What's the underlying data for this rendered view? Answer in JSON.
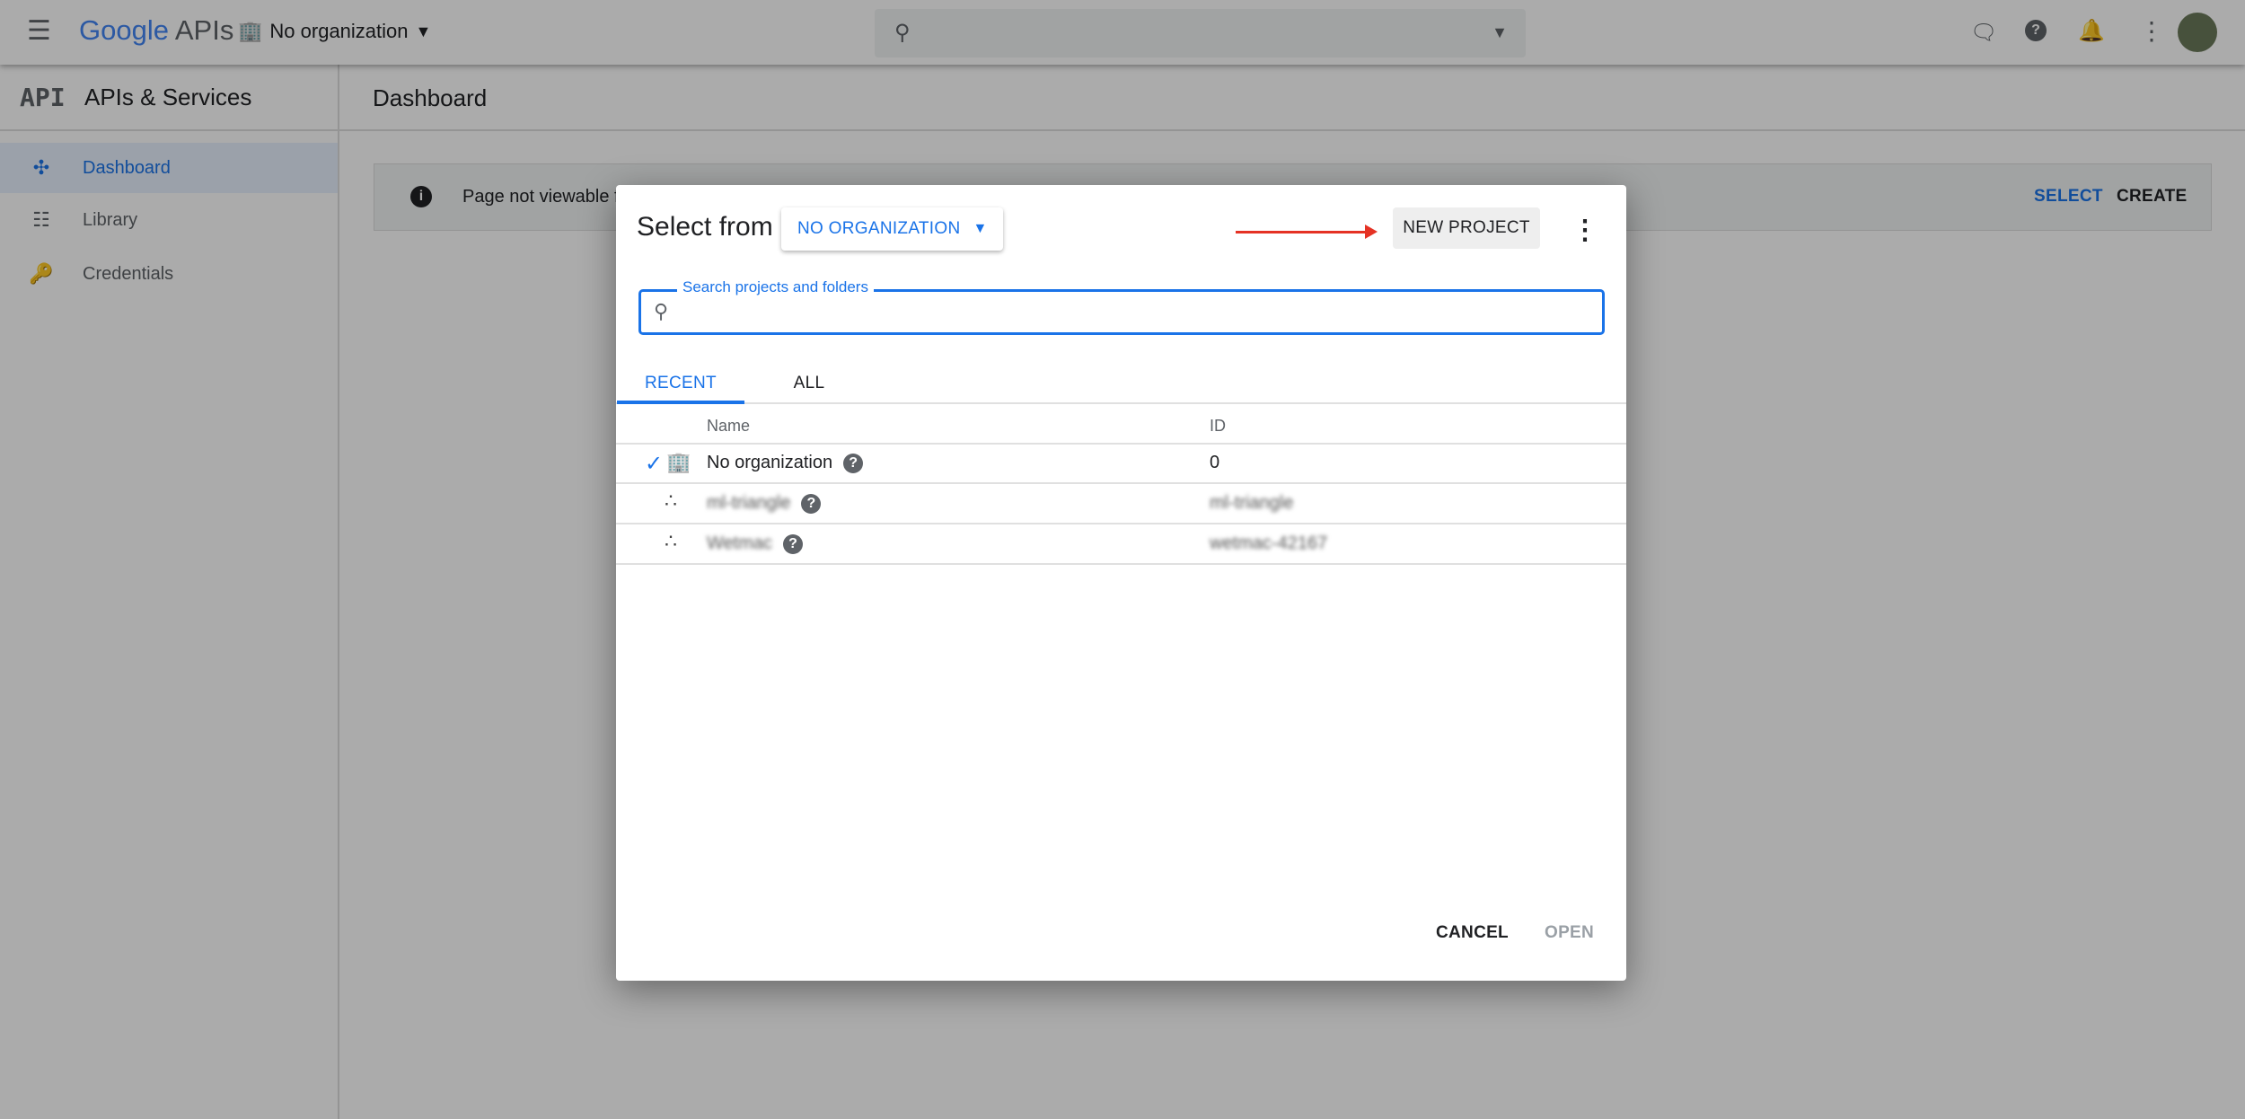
{
  "topbar": {
    "brand_google": "Google",
    "brand_apis": "APIs",
    "org_label": "No organization",
    "search_placeholder": ""
  },
  "sidebar": {
    "title": "APIs & Services",
    "logo": "API",
    "items": [
      {
        "label": "Dashboard",
        "icon": "dashboard-icon",
        "active": true
      },
      {
        "label": "Library",
        "icon": "library-icon"
      },
      {
        "label": "Credentials",
        "icon": "key-icon"
      }
    ]
  },
  "main": {
    "title": "Dashboard",
    "banner_text": "Page not viewable f",
    "banner_select": "SELECT",
    "banner_create": "CREATE"
  },
  "dialog": {
    "title": "Select from",
    "org_dropdown": "NO ORGANIZATION",
    "new_project": "NEW PROJECT",
    "search_label": "Search projects and folders",
    "tabs": [
      {
        "label": "RECENT",
        "active": true
      },
      {
        "label": "ALL"
      }
    ],
    "columns": [
      "Name",
      "ID"
    ],
    "rows": [
      {
        "name": "No organization",
        "id": "0",
        "type": "organization",
        "selected": true
      },
      {
        "name": "ml-triangle",
        "id": "ml-triangle",
        "type": "project"
      },
      {
        "name": "Wetmac",
        "id": "wetmac-42167",
        "type": "project"
      }
    ],
    "cancel": "CANCEL",
    "open": "OPEN"
  },
  "colors": {
    "accent": "#1a73e8",
    "arrow": "#e53224"
  }
}
